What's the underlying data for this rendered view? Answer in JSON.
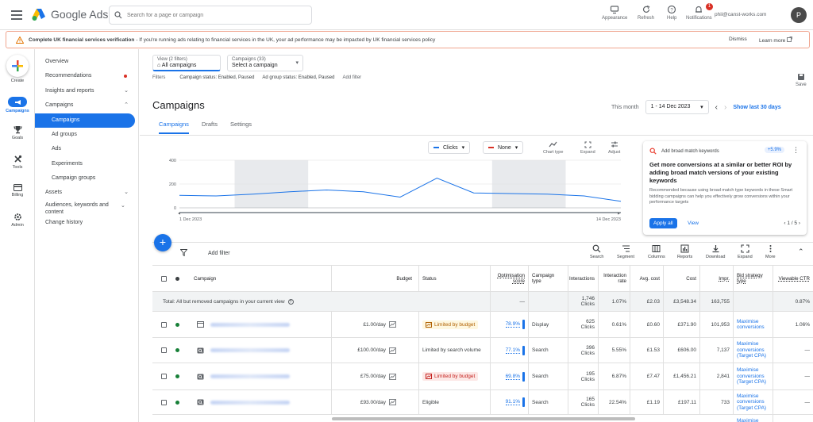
{
  "app": {
    "logo_text": "Google Ads",
    "search_placeholder": "Search for a page or campaign",
    "actions": [
      {
        "label": "Appearance",
        "icon": "appearance-icon"
      },
      {
        "label": "Refresh",
        "icon": "refresh-icon"
      },
      {
        "label": "Help",
        "icon": "help-icon"
      },
      {
        "label": "Notifications",
        "icon": "bell-icon",
        "badge": "1"
      }
    ],
    "account_email": "phil@canst-works.com",
    "avatar_letter": "P"
  },
  "banner": {
    "title": "Complete UK financial services verification",
    "message": "- If you're running ads relating to financial services in the UK, your ad performance may be impacted by UK financial services policy",
    "dismiss": "Dismiss",
    "learn_more": "Learn more"
  },
  "rail": [
    {
      "label": "Create",
      "icon": "plus-icon"
    },
    {
      "label": "Campaigns",
      "icon": "megaphone-icon",
      "active": true
    },
    {
      "label": "Goals",
      "icon": "trophy-icon"
    },
    {
      "label": "Tools",
      "icon": "tools-icon"
    },
    {
      "label": "Billing",
      "icon": "card-icon"
    },
    {
      "label": "Admin",
      "icon": "gear-icon"
    }
  ],
  "sidebar": {
    "items": [
      {
        "label": "Overview"
      },
      {
        "label": "Recommendations"
      },
      {
        "label": "Insights and reports"
      },
      {
        "label": "Campaigns"
      },
      {
        "label": "Campaigns"
      },
      {
        "label": "Ad groups"
      },
      {
        "label": "Ads"
      },
      {
        "label": "Experiments"
      },
      {
        "label": "Campaign groups"
      },
      {
        "label": "Assets"
      },
      {
        "label": "Audiences, keywords and content"
      },
      {
        "label": "Change history"
      }
    ]
  },
  "main": {
    "view_dd": {
      "label": "View (2 filters)",
      "value": "All campaigns"
    },
    "campaigns_dd": {
      "label": "Campaigns (33)",
      "value": "Select a campaign"
    },
    "filters_label": "Filters",
    "filter_chips": [
      "Campaign status: Enabled, Paused",
      "Ad group status: Enabled, Paused"
    ],
    "add_filter_top": "Add filter",
    "save": "Save",
    "title": "Campaigns",
    "this_month": "This month",
    "date_range": "1 - 14 Dec 2023",
    "show_last": "Show last 30 days",
    "tabs": [
      "Campaigns",
      "Drafts",
      "Settings"
    ]
  },
  "chart_controls": {
    "metric1": "Clicks",
    "metric2": "None",
    "tools": [
      "Chart type",
      "Expand",
      "Adjust"
    ],
    "metric1_color": "#1a73e8",
    "metric2_color": "#d93025"
  },
  "chart_data": {
    "type": "line",
    "title": "",
    "xlabel": "",
    "ylabel": "",
    "yticks": [
      "400",
      "200",
      "0"
    ],
    "ylim": [
      0,
      400
    ],
    "x_start_label": "1 Dec 2023",
    "x_end_label": "14 Dec 2023",
    "series": [
      {
        "name": "Clicks",
        "values": [
          105,
          100,
          115,
          135,
          150,
          135,
          90,
          250,
          125,
          120,
          115,
          100,
          55
        ]
      }
    ],
    "weekend_shading": [
      [
        2,
        3
      ],
      [
        9,
        10
      ]
    ]
  },
  "recommendation": {
    "header": "Add broad match keywords",
    "uplift": "+5.9%",
    "title": "Get more conversions at a similar or better ROI by adding broad match versions of your existing keywords",
    "body": "Recommended because using broad match type keywords in these Smart bidding campaigns can help you effectively grow conversions within your performance targets",
    "apply": "Apply all",
    "view": "View",
    "pager": "1 / 5"
  },
  "table_toolbar": {
    "add_filter": "Add filter",
    "tools": [
      "Search",
      "Segment",
      "Columns",
      "Reports",
      "Download",
      "Expand",
      "More"
    ]
  },
  "table": {
    "headers": [
      "Campaign",
      "Budget",
      "Status",
      "Optimisation score",
      "Campaign type",
      "Interactions",
      "Interaction rate",
      "Avg. cost",
      "Cost",
      "Impr.",
      "Bid strategy type",
      "Viewable CTR"
    ],
    "total": {
      "label": "Total: All but removed campaigns in your current view",
      "opt": "—",
      "interactions": "1,746",
      "interactions_unit": "Clicks",
      "rate": "1.07%",
      "avg_cost": "£2.03",
      "cost": "£3,548.34",
      "impr": "163,755",
      "ctr": "0.87%"
    },
    "rows": [
      {
        "budget": "£1.00/day",
        "status": "Limited by budget",
        "status_kind": "amber",
        "opt": "78.9%",
        "type": "Display",
        "interactions": "625",
        "unit": "Clicks",
        "rate": "0.61%",
        "avg_cost": "£0.60",
        "cost": "£371.90",
        "impr": "101,953",
        "bid": "Maximise conversions",
        "ctr": "1.06%"
      },
      {
        "budget": "£100.00/day",
        "status": "Limited by search volume",
        "status_kind": "plain",
        "opt": "77.1%",
        "type": "Search",
        "interactions": "396",
        "unit": "Clicks",
        "rate": "5.55%",
        "avg_cost": "£1.53",
        "cost": "£606.00",
        "impr": "7,137",
        "bid": "Maximise conversions (Target CPA)",
        "ctr": "—"
      },
      {
        "budget": "£75.00/day",
        "status": "Limited by budget",
        "status_kind": "red",
        "opt": "69.8%",
        "type": "Search",
        "interactions": "195",
        "unit": "Clicks",
        "rate": "6.87%",
        "avg_cost": "£7.47",
        "cost": "£1,456.21",
        "impr": "2,841",
        "bid": "Maximise conversions (Target CPA)",
        "ctr": "—"
      },
      {
        "budget": "£93.00/day",
        "status": "Eligible",
        "status_kind": "plain",
        "opt": "91.1%",
        "type": "Search",
        "interactions": "165",
        "unit": "Clicks",
        "rate": "22.54%",
        "avg_cost": "£1.19",
        "cost": "£197.11",
        "impr": "733",
        "bid": "Maximise conversions (Target CPA)",
        "ctr": "—"
      }
    ],
    "partial_row_bid": "Maximise"
  }
}
